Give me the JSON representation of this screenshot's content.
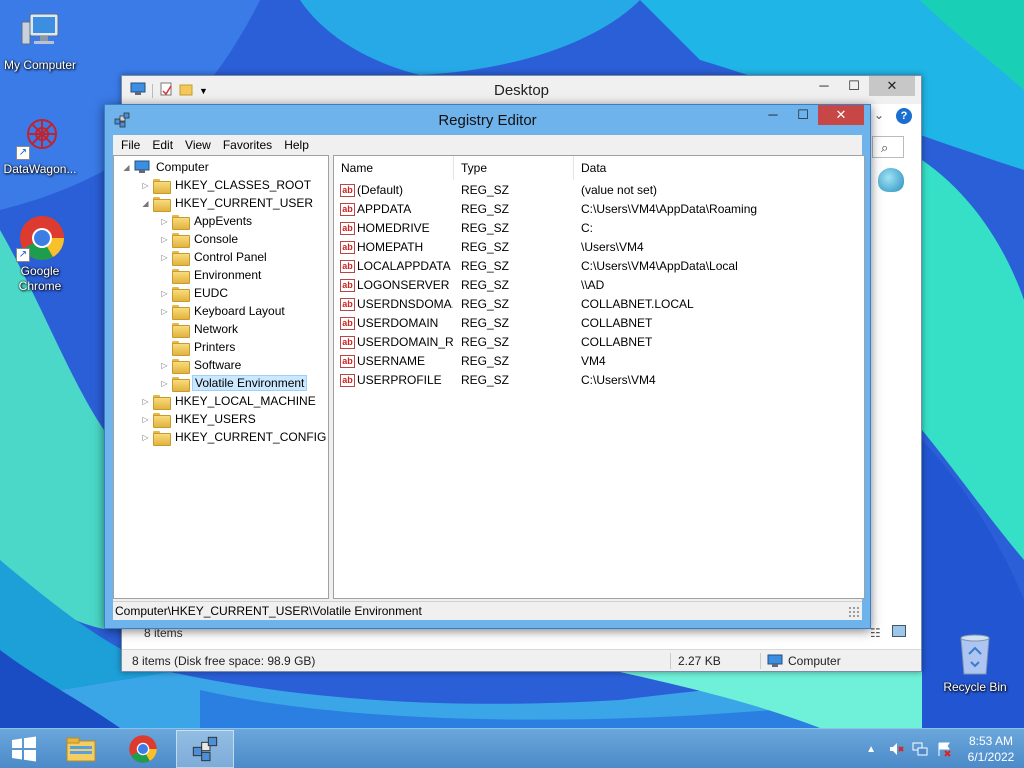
{
  "desktop": {
    "icons": [
      {
        "label": "My Computer"
      },
      {
        "label": "DataWagon..."
      },
      {
        "label": "Google Chrome"
      },
      {
        "label": "Recycle Bin"
      }
    ]
  },
  "explorer": {
    "title": "Desktop",
    "items_count": "8 items",
    "status_left": "8 items (Disk free space: 98.9 GB)",
    "status_size": "2.27 KB",
    "status_location": "Computer"
  },
  "regedit": {
    "title": "Registry Editor",
    "menu": [
      "File",
      "Edit",
      "View",
      "Favorites",
      "Help"
    ],
    "tree": {
      "root": "Computer",
      "hives": [
        "HKEY_CLASSES_ROOT",
        "HKEY_CURRENT_USER",
        "HKEY_LOCAL_MACHINE",
        "HKEY_USERS",
        "HKEY_CURRENT_CONFIG"
      ],
      "hkcu_children": [
        "AppEvents",
        "Console",
        "Control Panel",
        "Environment",
        "EUDC",
        "Keyboard Layout",
        "Network",
        "Printers",
        "Software",
        "Volatile Environment"
      ],
      "selected": "Volatile Environment"
    },
    "columns": [
      "Name",
      "Type",
      "Data"
    ],
    "values": [
      {
        "name": "(Default)",
        "type": "REG_SZ",
        "data": "(value not set)"
      },
      {
        "name": "APPDATA",
        "type": "REG_SZ",
        "data": "C:\\Users\\VM4\\AppData\\Roaming"
      },
      {
        "name": "HOMEDRIVE",
        "type": "REG_SZ",
        "data": "C:"
      },
      {
        "name": "HOMEPATH",
        "type": "REG_SZ",
        "data": "\\Users\\VM4"
      },
      {
        "name": "LOCALAPPDATA",
        "type": "REG_SZ",
        "data": "C:\\Users\\VM4\\AppData\\Local"
      },
      {
        "name": "LOGONSERVER",
        "type": "REG_SZ",
        "data": "\\\\AD"
      },
      {
        "name": "USERDNSDOMA...",
        "type": "REG_SZ",
        "data": "COLLABNET.LOCAL"
      },
      {
        "name": "USERDOMAIN",
        "type": "REG_SZ",
        "data": "COLLABNET"
      },
      {
        "name": "USERDOMAIN_R...",
        "type": "REG_SZ",
        "data": "COLLABNET"
      },
      {
        "name": "USERNAME",
        "type": "REG_SZ",
        "data": "VM4"
      },
      {
        "name": "USERPROFILE",
        "type": "REG_SZ",
        "data": "C:\\Users\\VM4"
      }
    ],
    "status_path": "Computer\\HKEY_CURRENT_USER\\Volatile Environment"
  },
  "taskbar": {
    "time": "8:53 AM",
    "date": "6/1/2022"
  },
  "colors": {
    "regedit_frame": "#6fb3ec",
    "close_red": "#c74646",
    "taskbar": "#5b98d2",
    "selection": "#cce8ff"
  }
}
